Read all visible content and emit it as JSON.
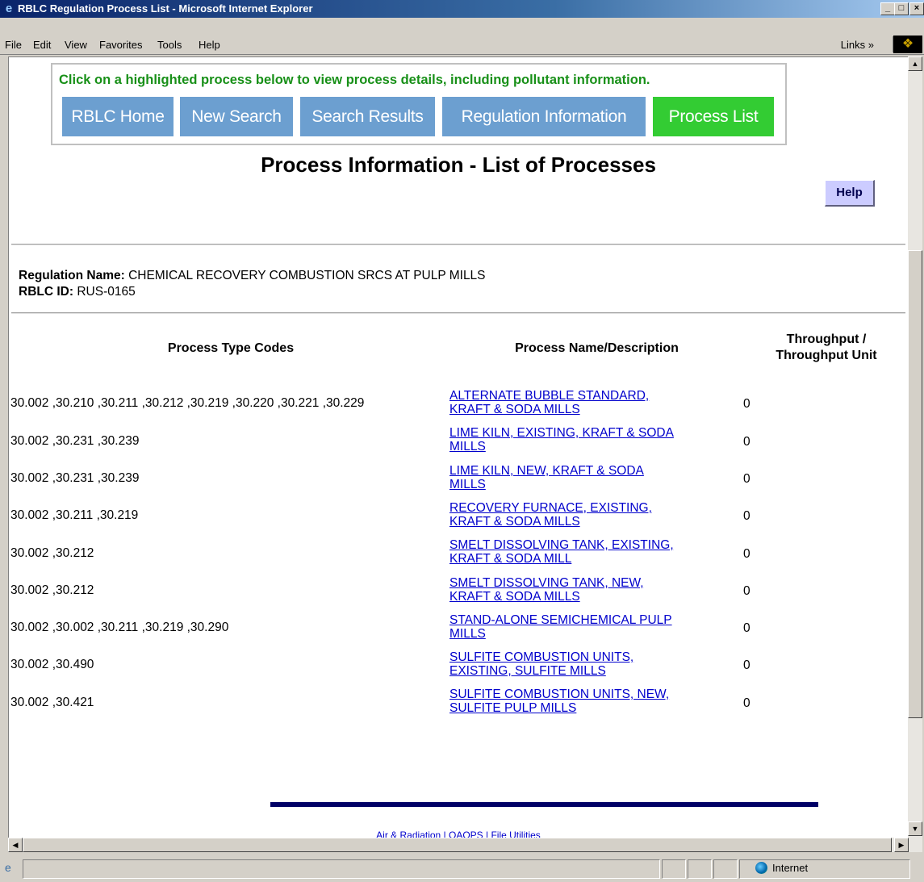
{
  "window": {
    "title": "RBLC Regulation Process List - Microsoft Internet Explorer",
    "minimize": "_",
    "maximize": "□",
    "close": "×"
  },
  "menu": {
    "items": [
      "File",
      "Edit",
      "View",
      "Favorites",
      "Tools",
      "Help"
    ],
    "links": "Links »"
  },
  "page": {
    "instructions": "Click on a highlighted process below to view process details, including pollutant information.",
    "nav": [
      "RBLC Home",
      "New Search",
      "Search Results",
      "Regulation Information",
      "Process List"
    ],
    "heading": "Process Information - List of Processes",
    "help": "Help",
    "regulation_label": "Regulation Name:",
    "regulation_name": "CHEMICAL RECOVERY COMBUSTION SRCS AT PULP MILLS",
    "rblc_label": "RBLC ID:",
    "rblc_id": "RUS-0165",
    "columns": {
      "codes": "Process Type Codes",
      "name": "Process Name/Description",
      "throughput_1": "Throughput /",
      "throughput_2": "Throughput Unit"
    },
    "rows": [
      {
        "codes": "30.002 ,30.210 ,30.211 ,30.212 ,30.219 ,30.220 ,30.221 ,30.229",
        "name_1": "ALTERNATE BUBBLE STANDARD,",
        "name_2": "KRAFT & SODA MILLS",
        "throughput": "0"
      },
      {
        "codes": "30.002 ,30.231 ,30.239",
        "name_1": "LIME KILN, EXISTING, KRAFT & SODA",
        "name_2": "MILLS",
        "throughput": "0"
      },
      {
        "codes": "30.002 ,30.231 ,30.239",
        "name_1": "LIME KILN, NEW, KRAFT & SODA",
        "name_2": "MILLS",
        "throughput": "0"
      },
      {
        "codes": "30.002 ,30.211 ,30.219",
        "name_1": "RECOVERY FURNACE, EXISTING,",
        "name_2": "KRAFT & SODA MILLS",
        "throughput": "0"
      },
      {
        "codes": "30.002 ,30.212",
        "name_1": "SMELT DISSOLVING TANK, EXISTING,",
        "name_2": "KRAFT & SODA MILL",
        "throughput": "0"
      },
      {
        "codes": "30.002 ,30.212",
        "name_1": "SMELT DISSOLVING TANK, NEW,",
        "name_2": "KRAFT & SODA MILLS",
        "throughput": "0"
      },
      {
        "codes": "30.002 ,30.002 ,30.211 ,30.219 ,30.290",
        "name_1": "STAND-ALONE SEMICHEMICAL PULP",
        "name_2": "MILLS",
        "throughput": "0"
      },
      {
        "codes": "30.002 ,30.490",
        "name_1": "SULFITE COMBUSTION UNITS,",
        "name_2": "EXISTING, SULFITE MILLS",
        "throughput": "0"
      },
      {
        "codes": "30.002 ,30.421",
        "name_1": "SULFITE COMBUSTION UNITS, NEW,",
        "name_2": "SULFITE PULP MILLS",
        "throughput": "0"
      }
    ],
    "footer_links": "Air & Radiation | OAQPS | File Utilities"
  },
  "status": {
    "zone": "Internet"
  },
  "colors": {
    "nav_blue": "#6c9fd0",
    "nav_green": "#33cc33",
    "instructions_green": "#189018",
    "link_blue": "#0000cc"
  }
}
